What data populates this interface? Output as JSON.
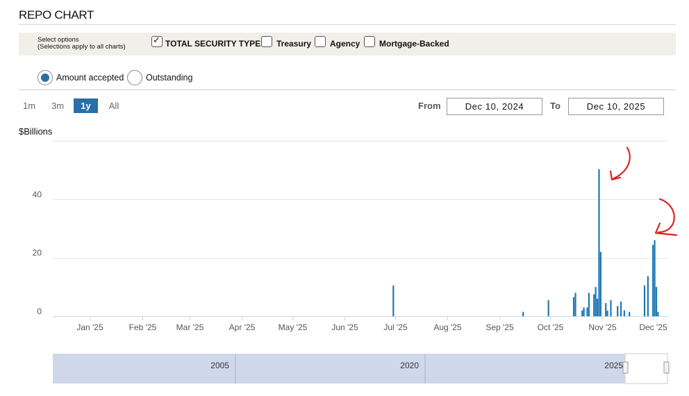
{
  "title": "REPO CHART",
  "options": {
    "help_line1": "Select options",
    "help_line2": "(Selections apply to all charts)",
    "checkboxes": [
      {
        "label": "TOTAL SECURITY TYPES",
        "checked": true
      },
      {
        "label": "Treasury",
        "checked": false
      },
      {
        "label": "Agency",
        "checked": false
      },
      {
        "label": "Mortgage-Backed",
        "checked": false
      }
    ]
  },
  "measure": {
    "options": [
      {
        "label": "Amount accepted",
        "selected": true
      },
      {
        "label": "Outstanding",
        "selected": false
      }
    ]
  },
  "range": {
    "buttons": [
      {
        "label": "1m",
        "active": false
      },
      {
        "label": "3m",
        "active": false
      },
      {
        "label": "1y",
        "active": true
      },
      {
        "label": "All",
        "active": false
      }
    ],
    "from_label": "From",
    "from_value": "Dec 10, 2024",
    "to_label": "To",
    "to_value": "Dec 10, 2025"
  },
  "colors": {
    "accent": "#2a6fa6",
    "bar": "#1f77b4",
    "navigator_fill": "#cfd8ea",
    "annotation": "#e02020"
  },
  "chart_data": {
    "type": "bar",
    "ylabel": "$Billions",
    "ylim": [
      0,
      60
    ],
    "y_ticks": [
      0,
      20,
      40
    ],
    "x_range": [
      "2024-12-10",
      "2025-12-10"
    ],
    "x_tick_labels": [
      "Jan '25",
      "Feb '25",
      "Mar '25",
      "Apr '25",
      "May '25",
      "Jun '25",
      "Jul '25",
      "Aug '25",
      "Sep '25",
      "Oct '25",
      "Nov '25",
      "Dec '25"
    ],
    "x_tick_dates": [
      "2025-01-01",
      "2025-02-01",
      "2025-03-01",
      "2025-04-01",
      "2025-05-01",
      "2025-06-01",
      "2025-07-01",
      "2025-08-01",
      "2025-09-01",
      "2025-10-01",
      "2025-11-01",
      "2025-12-01"
    ],
    "grid": true,
    "series": [
      {
        "x": [
          "2025-06-30",
          "2025-09-15",
          "2025-09-30",
          "2025-10-15",
          "2025-10-16",
          "2025-10-20",
          "2025-10-21",
          "2025-10-23",
          "2025-10-24",
          "2025-10-27",
          "2025-10-28",
          "2025-10-29",
          "2025-10-30",
          "2025-10-31",
          "2025-11-03",
          "2025-11-04",
          "2025-11-06",
          "2025-11-10",
          "2025-11-12",
          "2025-11-14",
          "2025-11-17",
          "2025-11-26",
          "2025-11-28",
          "2025-12-01",
          "2025-12-02",
          "2025-12-03",
          "2025-12-04"
        ],
        "values": [
          10.5,
          1.5,
          5.5,
          6.5,
          8,
          2,
          3,
          3,
          8,
          7.5,
          10,
          6,
          50.3,
          22,
          4.5,
          1.9,
          5.5,
          3.5,
          5,
          2,
          1.5,
          10.5,
          13.7,
          24.4,
          26,
          10,
          1.5
        ]
      }
    ],
    "navigator": {
      "labels": [
        "2005",
        "2020",
        "2025"
      ]
    }
  }
}
